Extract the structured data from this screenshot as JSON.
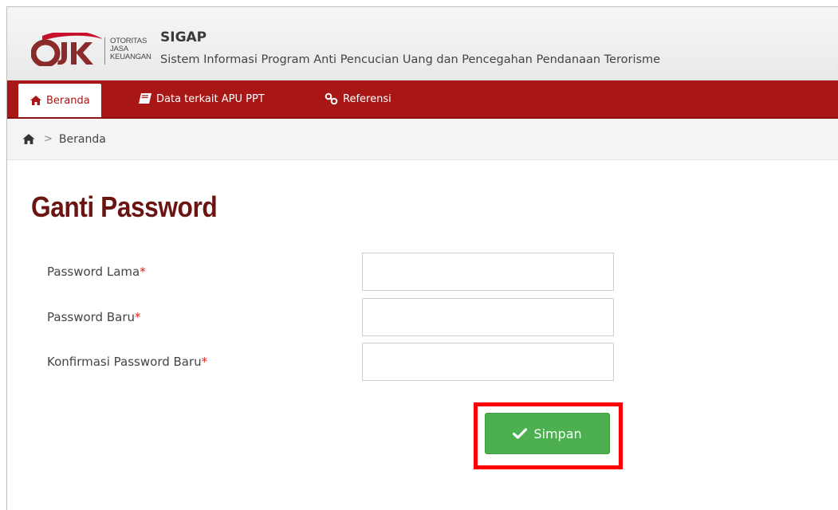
{
  "header": {
    "logo_text": [
      "OTORITAS",
      "JASA",
      "KEUANGAN"
    ],
    "app_title": "SIGAP",
    "app_subtitle": "Sistem Informasi Program Anti Pencucian Uang dan Pencegahan Pendanaan Terorisme"
  },
  "navbar": {
    "items": [
      {
        "label": "Beranda",
        "icon": "home-icon",
        "active": true
      },
      {
        "label": "Data terkait APU PPT",
        "icon": "book-icon",
        "active": false
      },
      {
        "label": "Referensi",
        "icon": "link-icon",
        "active": false
      }
    ]
  },
  "breadcrumb": {
    "home_icon": "home-icon",
    "current": "Beranda"
  },
  "page": {
    "title": "Ganti Password"
  },
  "form": {
    "fields": [
      {
        "label": "Password Lama",
        "required_mark": "*",
        "value": ""
      },
      {
        "label": "Password Baru",
        "required_mark": "*",
        "value": ""
      },
      {
        "label": "Konfirmasi Password Baru",
        "required_mark": "*",
        "value": ""
      }
    ],
    "submit_label": "Simpan",
    "submit_icon": "check-icon"
  },
  "colors": {
    "brand_red": "#a81616",
    "title_red": "#6b1512",
    "save_green": "#4caf50",
    "highlight": "#ff0000"
  }
}
